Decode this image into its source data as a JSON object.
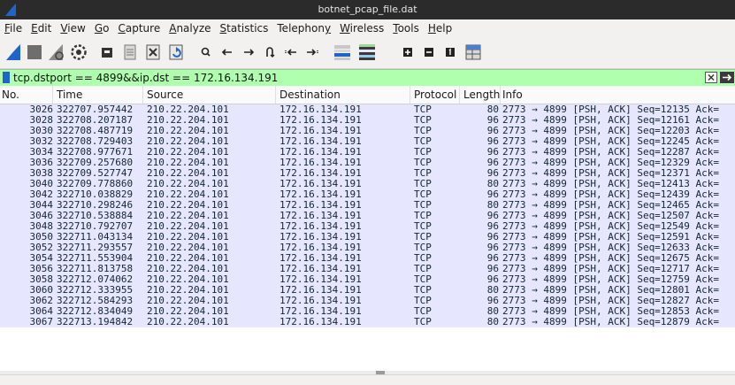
{
  "window": {
    "title": "botnet_pcap_file.dat"
  },
  "menu": [
    {
      "pre": "",
      "u": "F",
      "post": "ile"
    },
    {
      "pre": "",
      "u": "E",
      "post": "dit"
    },
    {
      "pre": "",
      "u": "V",
      "post": "iew"
    },
    {
      "pre": "",
      "u": "G",
      "post": "o"
    },
    {
      "pre": "",
      "u": "C",
      "post": "apture"
    },
    {
      "pre": "",
      "u": "A",
      "post": "nalyze"
    },
    {
      "pre": "",
      "u": "S",
      "post": "tatistics"
    },
    {
      "pre": "Telephon",
      "u": "y",
      "post": ""
    },
    {
      "pre": "",
      "u": "W",
      "post": "ireless"
    },
    {
      "pre": "",
      "u": "T",
      "post": "ools"
    },
    {
      "pre": "",
      "u": "H",
      "post": "elp"
    }
  ],
  "filter": {
    "value": "tcp.dstport == 4899&&ip.dst == 172.16.134.191"
  },
  "columns": {
    "no": "No.",
    "time": "Time",
    "source": "Source",
    "destination": "Destination",
    "protocol": "Protocol",
    "length": "Length",
    "info": "Info"
  },
  "rows": [
    {
      "no": "3026",
      "time": "322707.957442",
      "src": "210.22.204.101",
      "dst": "172.16.134.191",
      "proto": "TCP",
      "len": "80",
      "info": "2773 → 4899 [PSH, ACK] Seq=12135 Ack="
    },
    {
      "no": "3028",
      "time": "322708.207187",
      "src": "210.22.204.101",
      "dst": "172.16.134.191",
      "proto": "TCP",
      "len": "96",
      "info": "2773 → 4899 [PSH, ACK] Seq=12161 Ack="
    },
    {
      "no": "3030",
      "time": "322708.487719",
      "src": "210.22.204.101",
      "dst": "172.16.134.191",
      "proto": "TCP",
      "len": "96",
      "info": "2773 → 4899 [PSH, ACK] Seq=12203 Ack="
    },
    {
      "no": "3032",
      "time": "322708.729403",
      "src": "210.22.204.101",
      "dst": "172.16.134.191",
      "proto": "TCP",
      "len": "96",
      "info": "2773 → 4899 [PSH, ACK] Seq=12245 Ack="
    },
    {
      "no": "3034",
      "time": "322708.977671",
      "src": "210.22.204.101",
      "dst": "172.16.134.191",
      "proto": "TCP",
      "len": "96",
      "info": "2773 → 4899 [PSH, ACK] Seq=12287 Ack="
    },
    {
      "no": "3036",
      "time": "322709.257680",
      "src": "210.22.204.101",
      "dst": "172.16.134.191",
      "proto": "TCP",
      "len": "96",
      "info": "2773 → 4899 [PSH, ACK] Seq=12329 Ack="
    },
    {
      "no": "3038",
      "time": "322709.527747",
      "src": "210.22.204.101",
      "dst": "172.16.134.191",
      "proto": "TCP",
      "len": "96",
      "info": "2773 → 4899 [PSH, ACK] Seq=12371 Ack="
    },
    {
      "no": "3040",
      "time": "322709.778860",
      "src": "210.22.204.101",
      "dst": "172.16.134.191",
      "proto": "TCP",
      "len": "80",
      "info": "2773 → 4899 [PSH, ACK] Seq=12413 Ack="
    },
    {
      "no": "3042",
      "time": "322710.038829",
      "src": "210.22.204.101",
      "dst": "172.16.134.191",
      "proto": "TCP",
      "len": "96",
      "info": "2773 → 4899 [PSH, ACK] Seq=12439 Ack="
    },
    {
      "no": "3044",
      "time": "322710.298246",
      "src": "210.22.204.101",
      "dst": "172.16.134.191",
      "proto": "TCP",
      "len": "80",
      "info": "2773 → 4899 [PSH, ACK] Seq=12465 Ack="
    },
    {
      "no": "3046",
      "time": "322710.538884",
      "src": "210.22.204.101",
      "dst": "172.16.134.191",
      "proto": "TCP",
      "len": "96",
      "info": "2773 → 4899 [PSH, ACK] Seq=12507 Ack="
    },
    {
      "no": "3048",
      "time": "322710.792707",
      "src": "210.22.204.101",
      "dst": "172.16.134.191",
      "proto": "TCP",
      "len": "96",
      "info": "2773 → 4899 [PSH, ACK] Seq=12549 Ack="
    },
    {
      "no": "3050",
      "time": "322711.043134",
      "src": "210.22.204.101",
      "dst": "172.16.134.191",
      "proto": "TCP",
      "len": "96",
      "info": "2773 → 4899 [PSH, ACK] Seq=12591 Ack="
    },
    {
      "no": "3052",
      "time": "322711.293557",
      "src": "210.22.204.101",
      "dst": "172.16.134.191",
      "proto": "TCP",
      "len": "96",
      "info": "2773 → 4899 [PSH, ACK] Seq=12633 Ack="
    },
    {
      "no": "3054",
      "time": "322711.553904",
      "src": "210.22.204.101",
      "dst": "172.16.134.191",
      "proto": "TCP",
      "len": "96",
      "info": "2773 → 4899 [PSH, ACK] Seq=12675 Ack="
    },
    {
      "no": "3056",
      "time": "322711.813758",
      "src": "210.22.204.101",
      "dst": "172.16.134.191",
      "proto": "TCP",
      "len": "96",
      "info": "2773 → 4899 [PSH, ACK] Seq=12717 Ack="
    },
    {
      "no": "3058",
      "time": "322712.074062",
      "src": "210.22.204.101",
      "dst": "172.16.134.191",
      "proto": "TCP",
      "len": "96",
      "info": "2773 → 4899 [PSH, ACK] Seq=12759 Ack="
    },
    {
      "no": "3060",
      "time": "322712.333955",
      "src": "210.22.204.101",
      "dst": "172.16.134.191",
      "proto": "TCP",
      "len": "80",
      "info": "2773 → 4899 [PSH, ACK] Seq=12801 Ack="
    },
    {
      "no": "3062",
      "time": "322712.584293",
      "src": "210.22.204.101",
      "dst": "172.16.134.191",
      "proto": "TCP",
      "len": "96",
      "info": "2773 → 4899 [PSH, ACK] Seq=12827 Ack="
    },
    {
      "no": "3064",
      "time": "322712.834049",
      "src": "210.22.204.101",
      "dst": "172.16.134.191",
      "proto": "TCP",
      "len": "80",
      "info": "2773 → 4899 [PSH, ACK] Seq=12853 Ack="
    },
    {
      "no": "3067",
      "time": "322713.194842",
      "src": "210.22.204.101",
      "dst": "172.16.134.191",
      "proto": "TCP",
      "len": "80",
      "info": "2773 → 4899 [PSH, ACK] Seq=12879 Ack="
    }
  ],
  "colors": {
    "row_tcp_bg": "#e7e6ff",
    "filter_valid_bg": "#afffaf",
    "titlebar_bg": "#2b2b2b",
    "wireshark_fin": "#1f64c8"
  },
  "icons": {
    "app": "wireshark-fin-icon",
    "toolbar": [
      "start-capture-icon",
      "stop-capture-icon",
      "restart-capture-icon",
      "capture-options-icon",
      "open-file-icon",
      "save-file-icon",
      "close-file-icon",
      "reload-file-icon",
      "find-packet-icon",
      "go-back-icon",
      "go-forward-icon",
      "go-to-packet-icon",
      "go-first-icon",
      "go-last-icon",
      "auto-scroll-icon",
      "colorize-icon",
      "zoom-in-icon",
      "zoom-out-icon",
      "normal-size-icon",
      "resize-columns-icon"
    ]
  }
}
